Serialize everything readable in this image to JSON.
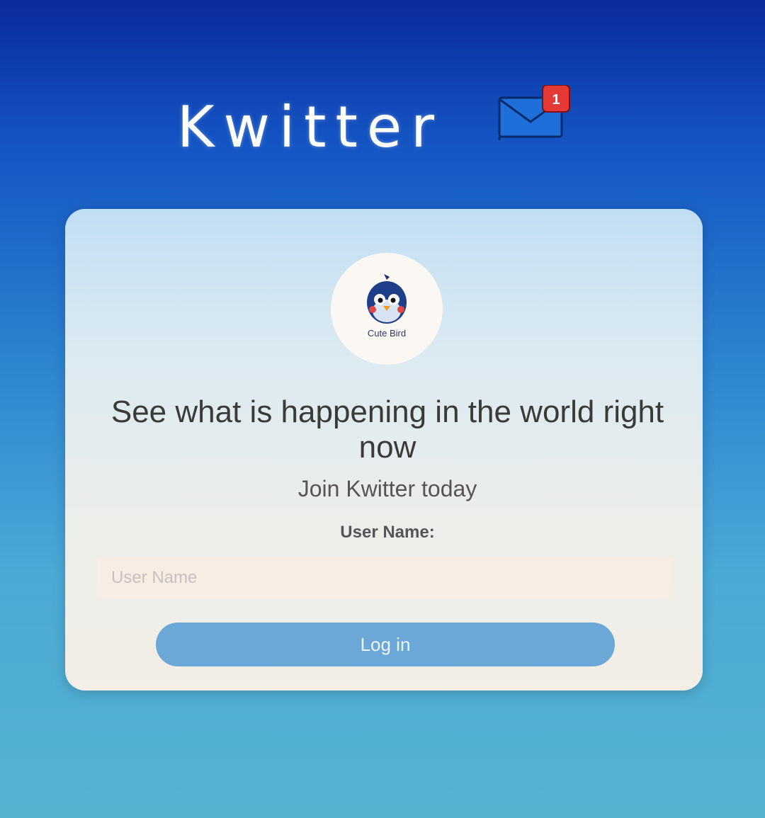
{
  "header": {
    "app_title": "Kwitter",
    "notification_icon": "mail-notification-icon",
    "notification_count": "1"
  },
  "card": {
    "logo": {
      "icon": "bird-icon",
      "caption": "Cute Bird"
    },
    "headline": "See what is happening in the world right now",
    "subheadline": "Join Kwitter today",
    "username": {
      "label": "User Name:",
      "placeholder": "User Name",
      "value": ""
    },
    "login_button_label": "Log in"
  },
  "colors": {
    "background_top": "#0b2a9c",
    "background_bottom": "#56b3cf",
    "button": "#6ba8d8",
    "badge": "#e53935",
    "envelope": "#1e6fd9"
  }
}
